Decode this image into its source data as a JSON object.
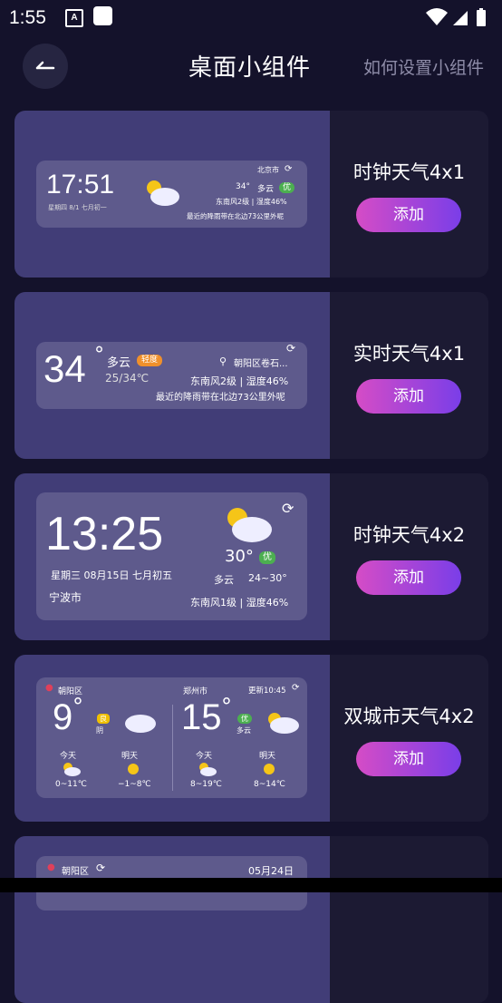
{
  "status": {
    "time": "1:55",
    "a_icon": "A"
  },
  "header": {
    "title": "桌面小组件",
    "howto": "如何设置小组件"
  },
  "cards": [
    {
      "name": "时钟天气4x1",
      "add": "添加",
      "w": {
        "time": "17:51",
        "date": "星期四 8/1  七月初一",
        "city": "北京市",
        "temp": "34°",
        "cond": "多云",
        "aqi": "优",
        "wind": "东南风2级 | 湿度46%",
        "rain": "最近的降雨带在北边73公里外呢"
      }
    },
    {
      "name": "实时天气4x1",
      "add": "添加",
      "w": {
        "temp": "34",
        "deg": "°",
        "cond": "多云",
        "aqi": "轻度",
        "range": "25/34℃",
        "loc": "朝阳区卷石...",
        "wind": "东南风2级 | 湿度46%",
        "rain": "最近的降雨带在北边73公里外呢"
      }
    },
    {
      "name": "时钟天气4x2",
      "add": "添加",
      "w": {
        "time": "13:25",
        "date": "星期三 08月15日 七月初五",
        "city": "宁波市",
        "temp": "30°",
        "aqi": "优",
        "cond": "多云",
        "range": "24~30°",
        "wind": "东南风1级 | 湿度46%"
      }
    },
    {
      "name": "双城市天气4x2",
      "add": "添加",
      "w": {
        "city1": "朝阳区",
        "city2": "郑州市",
        "update": "更新10:45",
        "c1": {
          "temp": "9",
          "deg": "°",
          "aqi": "良",
          "cond": "阴"
        },
        "c2": {
          "temp": "15",
          "deg": "°",
          "aqi": "优",
          "cond": "多云"
        },
        "f1": [
          {
            "day": "今天",
            "range": "0~11℃"
          },
          {
            "day": "明天",
            "range": "−1~8℃"
          }
        ],
        "f2": [
          {
            "day": "今天",
            "range": "8~19℃"
          },
          {
            "day": "明天",
            "range": "8~14℃"
          }
        ]
      }
    },
    {
      "w": {
        "city": "朝阳区",
        "date": "05月24日"
      }
    }
  ]
}
